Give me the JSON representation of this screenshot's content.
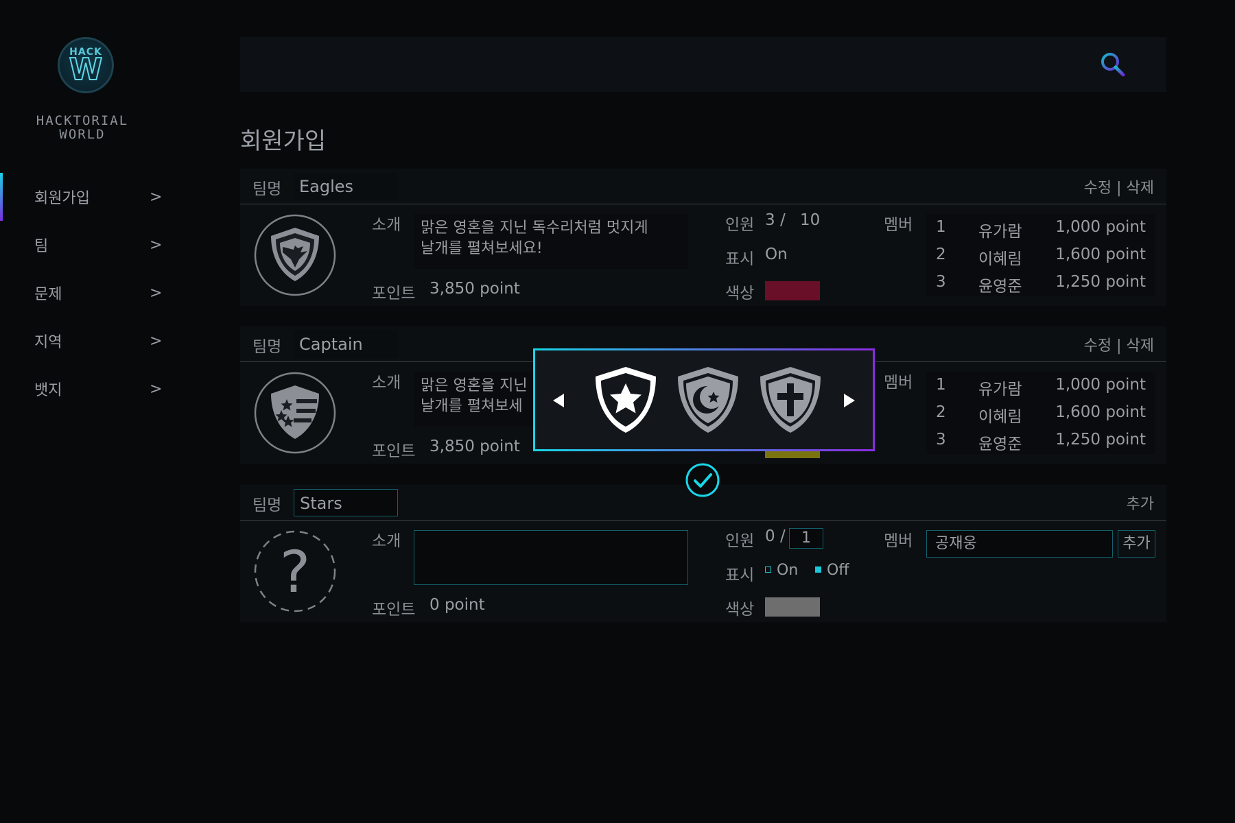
{
  "brand": {
    "badge_top": "HACK",
    "badge_letter": "W",
    "name": "HACKTORIAL WORLD"
  },
  "nav": [
    {
      "label": "회원가입",
      "chevron": ">"
    },
    {
      "label": "팀",
      "chevron": ">"
    },
    {
      "label": "문제",
      "chevron": ">"
    },
    {
      "label": "지역",
      "chevron": ">"
    },
    {
      "label": "뱃지",
      "chevron": ">"
    }
  ],
  "page_title": "회원가입",
  "labels": {
    "team_name": "팀명",
    "intro": "소개",
    "points": "포인트",
    "headcount": "인원",
    "display": "표시",
    "color": "색상",
    "members": "멤버",
    "edit_delete": "수정 | 삭제",
    "add": "추가"
  },
  "teams": [
    {
      "name": "Eagles",
      "intro": "맑은 영혼을 지닌 독수리처럼 멋지게\n날개를 펼쳐보세요!",
      "points": "3,850 point",
      "headcount_current": "3 /",
      "headcount_max": "10",
      "display": "On",
      "color": "#6a0f28",
      "emblem": "eagle-shield",
      "members": [
        {
          "no": "1",
          "name": "유가람",
          "points": "1,000 point"
        },
        {
          "no": "2",
          "name": "이혜림",
          "points": "1,600 point"
        },
        {
          "no": "3",
          "name": "윤영준",
          "points": "1,250 point"
        }
      ]
    },
    {
      "name": "Captain",
      "intro": "맑은 영혼을 지닌\n날개를 펼쳐보세",
      "points": "3,850 point",
      "color": "#7a7410",
      "emblem": "stars-stripes-shield",
      "members": [
        {
          "no": "1",
          "name": "유가람",
          "points": "1,000 point"
        },
        {
          "no": "2",
          "name": "이혜림",
          "points": "1,600 point"
        },
        {
          "no": "3",
          "name": "윤영준",
          "points": "1,250 point"
        }
      ]
    },
    {
      "name": "Stars",
      "intro": "",
      "points": "0 point",
      "headcount_current": "0 /",
      "headcount_max": "1",
      "display_on": "On",
      "display_off": "Off",
      "color": "#6e6e6e",
      "emblem": "question-mark",
      "member_input": "공재웅",
      "add_label": "추가"
    }
  ],
  "picker": {
    "options": [
      "star-shield-icon",
      "crescent-star-shield-icon",
      "cross-shield-icon"
    ],
    "selected_index": 0
  },
  "colors": {
    "accent_cyan": "#18d6e8",
    "accent_purple": "#8a2be2"
  }
}
